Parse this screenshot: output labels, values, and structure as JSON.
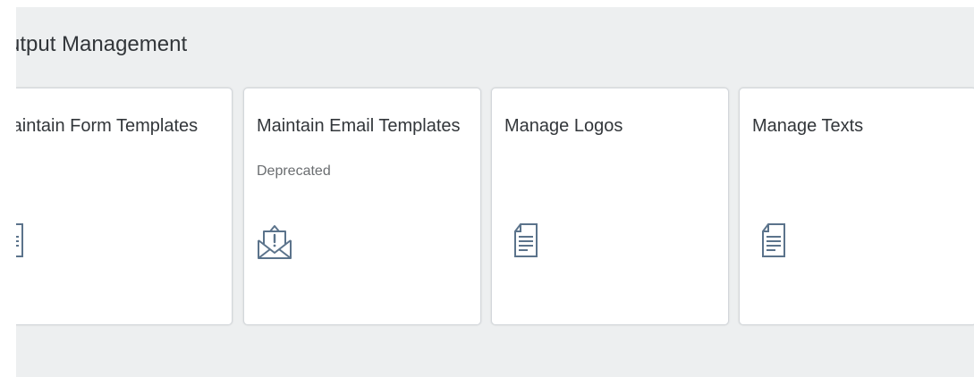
{
  "group": {
    "title": "utput Management"
  },
  "tiles": [
    {
      "title": "Maintain Form Templates",
      "subtitle": "",
      "icon": "document-text-icon"
    },
    {
      "title": "Maintain Email Templates",
      "subtitle": "Deprecated",
      "icon": "email-alert-icon"
    },
    {
      "title": "Manage Logos",
      "subtitle": "",
      "icon": "document-text-icon"
    },
    {
      "title": "Manage Texts",
      "subtitle": "",
      "icon": "document-text-icon"
    }
  ],
  "colors": {
    "background": "#edeff0",
    "tile": "#ffffff",
    "text": "#32363a",
    "subtext": "#6a6d70",
    "icon": "#5b738b"
  }
}
